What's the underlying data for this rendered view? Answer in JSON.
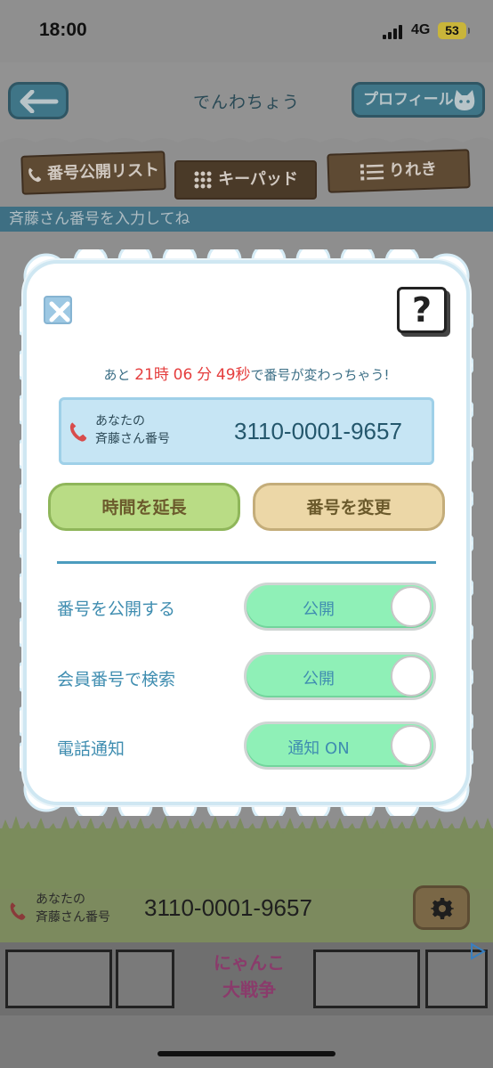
{
  "status_bar": {
    "time": "18:00",
    "network": "4G",
    "battery": "53"
  },
  "header": {
    "title": "でんわちょう",
    "profile_label": "プロフィール"
  },
  "tabs": [
    {
      "label": "番号公開リスト",
      "icon": "phone-icon"
    },
    {
      "label": "キーパッド",
      "icon": "keypad-icon"
    },
    {
      "label": "りれき",
      "icon": "list-icon"
    }
  ],
  "prompt": "斉藤さん番号を入力してね",
  "modal": {
    "help_label": "?",
    "countdown": {
      "prefix": "あと",
      "hours": "21",
      "hours_unit": "時",
      "minutes": "06",
      "minutes_unit": "分",
      "seconds": "49",
      "seconds_unit": "秒",
      "suffix": "で番号が変わっちゃう!"
    },
    "number_card": {
      "label_line1": "あなたの",
      "label_line2": "斉藤さん番号",
      "number": "3110-0001-9657"
    },
    "extend_button": "時間を延長",
    "change_button": "番号を変更",
    "settings": [
      {
        "label": "番号を公開する",
        "toggle_text": "公開"
      },
      {
        "label": "会員番号で検索",
        "toggle_text": "公開"
      },
      {
        "label": "電話通知",
        "toggle_text": "通知 ON"
      }
    ]
  },
  "bottom": {
    "label_line1": "あなたの",
    "label_line2": "斉藤さん番号",
    "number": "3110-0001-9657"
  },
  "ad": {
    "title_line1": "にゃんこ",
    "title_line2": "大戦争"
  }
}
